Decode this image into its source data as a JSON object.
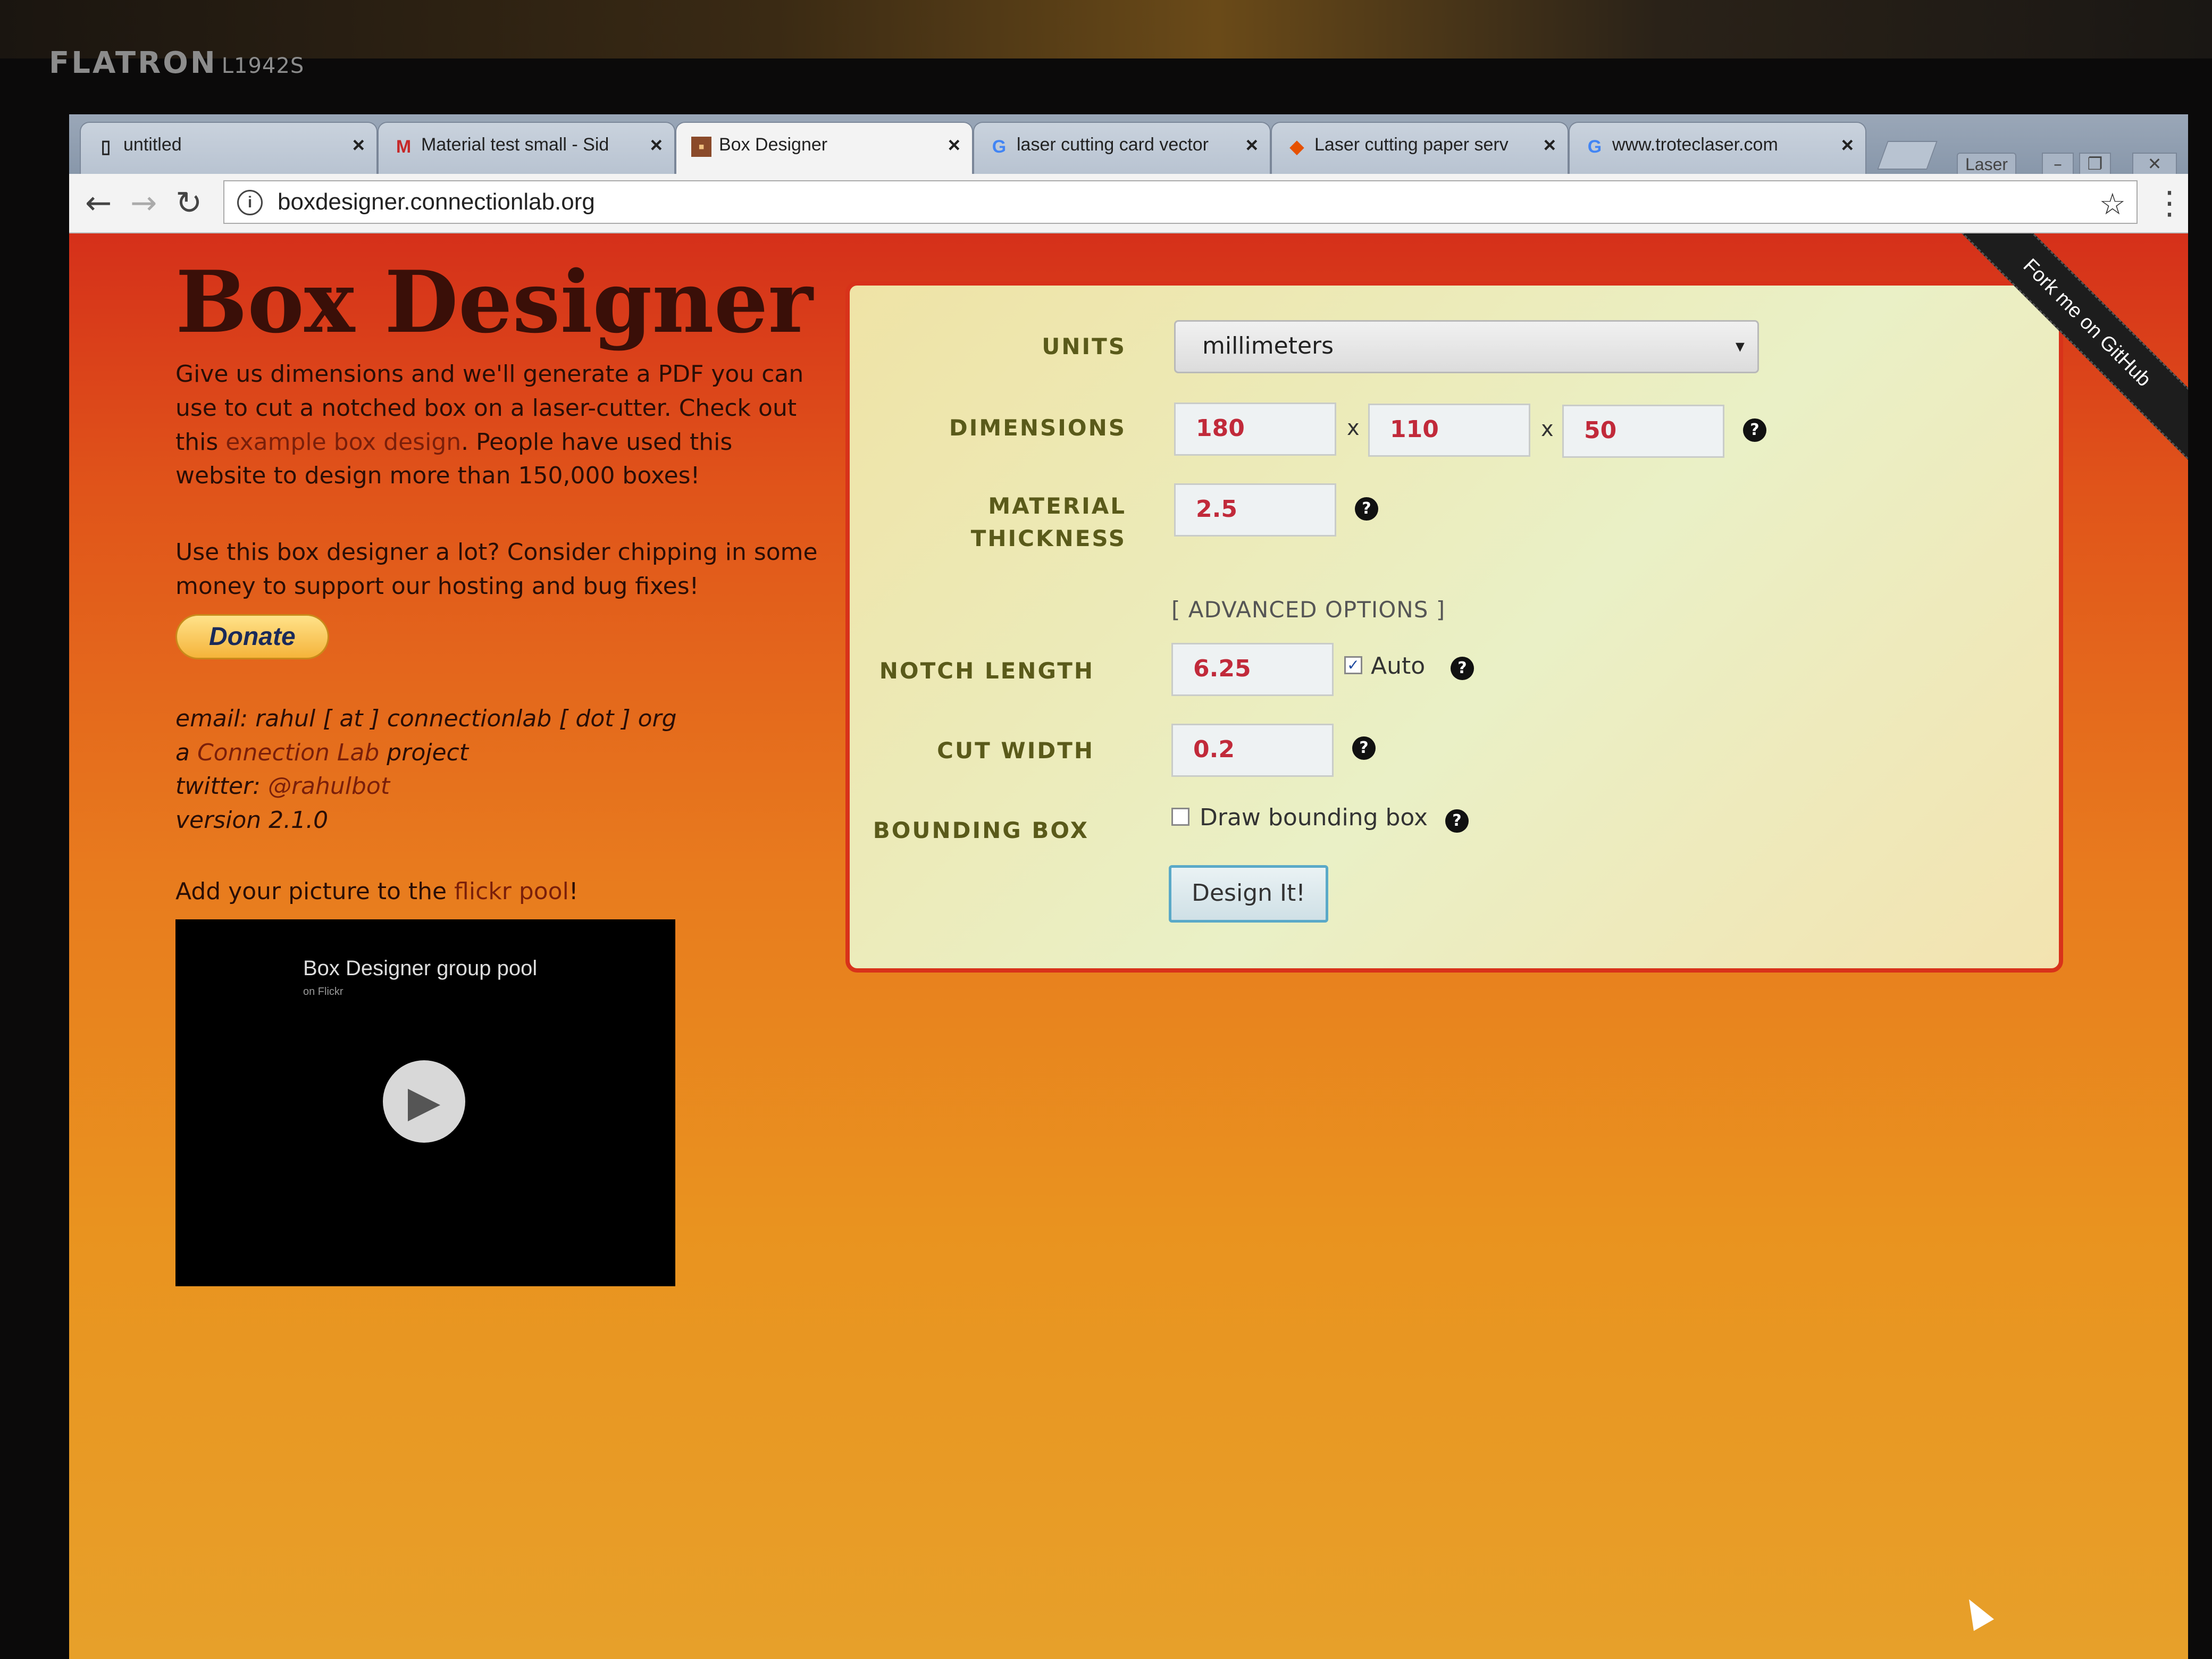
{
  "monitor": {
    "brand": "FLATRON",
    "model": "L1942S"
  },
  "browser": {
    "tabs": [
      {
        "label": "untitled",
        "icon": "document-icon"
      },
      {
        "label": "Material test small - Sid",
        "icon": "gmail-icon"
      },
      {
        "label": "Box Designer",
        "icon": "site-icon",
        "active": true
      },
      {
        "label": "laser cutting card vector",
        "icon": "google-icon"
      },
      {
        "label": "Laser cutting paper serv",
        "icon": "site-icon"
      },
      {
        "label": "www.troteclaser.com",
        "icon": "google-icon"
      }
    ],
    "close_glyph": "×",
    "profile": "Laser",
    "url": "boxdesigner.connectionlab.org"
  },
  "page": {
    "title": "Box Designer",
    "intro_1": "Give us dimensions and we'll generate a PDF you can use to cut a notched box on a laser-cutter. Check out this ",
    "intro_link": "example box design",
    "intro_2": ". People have used this website to design more than 150,000 boxes!",
    "donate_text": "Use this box designer a lot? Consider chipping in some money to support our hosting and bug fixes!",
    "donate_label": "Donate",
    "email": "email: rahul [ at ] connectionlab [ dot ] org",
    "project_prefix": "a ",
    "project_link": "Connection Lab",
    "project_suffix": " project",
    "twitter_prefix": "twitter: ",
    "twitter_link": "@rahulbot",
    "version": "version 2.1.0",
    "flickr_prefix": "Add your picture to the ",
    "flickr_link": "flickr pool",
    "flickr_suffix": "!",
    "flickr_widget_title": "Box Designer group pool",
    "flickr_widget_sub": "on Flickr",
    "ribbon": "Fork me on GitHub"
  },
  "form": {
    "units_label": "UNITS",
    "units_value": "millimeters",
    "dimensions_label": "DIMENSIONS",
    "dim_width": "180",
    "dim_height": "110",
    "dim_depth": "50",
    "dim_sep": "x",
    "thickness_label_1": "MATERIAL",
    "thickness_label_2": "THICKNESS",
    "thickness_value": "2.5",
    "advanced": "[ ADVANCED OPTIONS ]",
    "notch_label": "NOTCH LENGTH",
    "notch_value": "6.25",
    "auto_label": "Auto",
    "auto_checked": true,
    "cut_label": "CUT WIDTH",
    "cut_value": "0.2",
    "bbox_label": "BOUNDING BOX",
    "bbox_checkbox_label": "Draw bounding box",
    "bbox_checked": false,
    "design_button": "Design It!",
    "help_glyph": "?"
  },
  "colors": {
    "page_top": "#d5301a",
    "page_bottom": "#e7a02a",
    "panel_border": "#d8321a",
    "input_text": "#c12a3a"
  }
}
